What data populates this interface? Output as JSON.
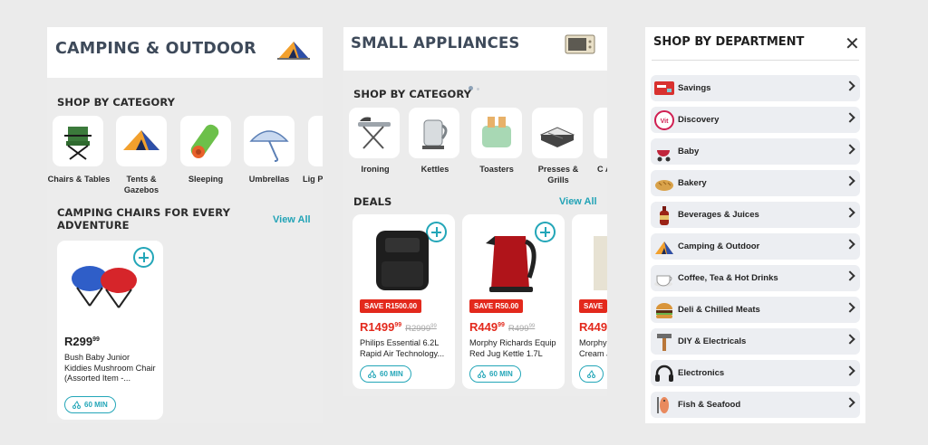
{
  "panel_camping": {
    "title": "CAMPING & OUTDOOR",
    "category_section_title": "SHOP BY CATEGORY",
    "categories": [
      {
        "label": "Chairs & Tables",
        "icon": "folding-chair-icon"
      },
      {
        "label": "Tents & Gazebos",
        "icon": "tent-icon"
      },
      {
        "label": "Sleeping",
        "icon": "sleeping-bag-icon"
      },
      {
        "label": "Umbrellas",
        "icon": "umbrella-icon"
      },
      {
        "label": "Lig P",
        "icon": "lighting-icon"
      }
    ],
    "deals_section_title": "CAMPING CHAIRS FOR EVERY ADVENTURE",
    "view_all": "View All",
    "products": [
      {
        "price_main": "R299",
        "price_cents": "99",
        "name": "Bush Baby Junior Kiddies Mushroom Chair (Assorted Item -...",
        "delivery": "60 MIN"
      }
    ]
  },
  "panel_appliances": {
    "title": "SMALL APPLIANCES",
    "category_section_title": "SHOP BY CATEGORY",
    "categories": [
      {
        "label": "Ironing",
        "icon": "ironing-board-icon"
      },
      {
        "label": "Kettles",
        "icon": "kettle-icon"
      },
      {
        "label": "Toasters",
        "icon": "toaster-icon"
      },
      {
        "label": "Presses & Grills",
        "icon": "sandwich-press-icon"
      },
      {
        "label": "C Ap",
        "icon": "coffee-machine-icon"
      }
    ],
    "deals_section_title": "DEALS",
    "view_all": "View All",
    "products": [
      {
        "save": "SAVE R1500.00",
        "price_main": "R1499",
        "price_cents": "99",
        "was_main": "R2999",
        "was_cents": "99",
        "name": "Philips Essential 6.2L Rapid Air Technology...",
        "delivery": "60 MIN"
      },
      {
        "save": "SAVE R50.00",
        "price_main": "R449",
        "price_cents": "99",
        "was_main": "R499",
        "was_cents": "99",
        "name": "Morphy Richards Equip Red Jug Kettle 1.7L",
        "delivery": "60 MIN"
      },
      {
        "save": "SAVE",
        "price_main": "R449",
        "price_cents": "",
        "was_main": "",
        "was_cents": "",
        "name": "Morphy Cream J",
        "delivery": "60 MIN"
      }
    ]
  },
  "panel_departments": {
    "title": "SHOP BY DEPARTMENT",
    "close_icon": "close-icon",
    "departments": [
      {
        "label": "Savings",
        "icon": "savings-card-icon"
      },
      {
        "label": "Discovery",
        "icon": "discovery-icon"
      },
      {
        "label": "Baby",
        "icon": "pram-icon"
      },
      {
        "label": "Bakery",
        "icon": "bread-icon"
      },
      {
        "label": "Beverages & Juices",
        "icon": "bottle-icon"
      },
      {
        "label": "Camping & Outdoor",
        "icon": "tent-icon"
      },
      {
        "label": "Coffee, Tea & Hot Drinks",
        "icon": "cup-icon"
      },
      {
        "label": "Deli & Chilled Meats",
        "icon": "burger-icon"
      },
      {
        "label": "DIY & Electricals",
        "icon": "hammer-icon"
      },
      {
        "label": "Electronics",
        "icon": "headphones-icon"
      },
      {
        "label": "Fish & Seafood",
        "icon": "fish-icon"
      }
    ]
  },
  "colors": {
    "accent": "#23a6b8",
    "sale": "#e3291c",
    "title": "#3e4a5a"
  }
}
